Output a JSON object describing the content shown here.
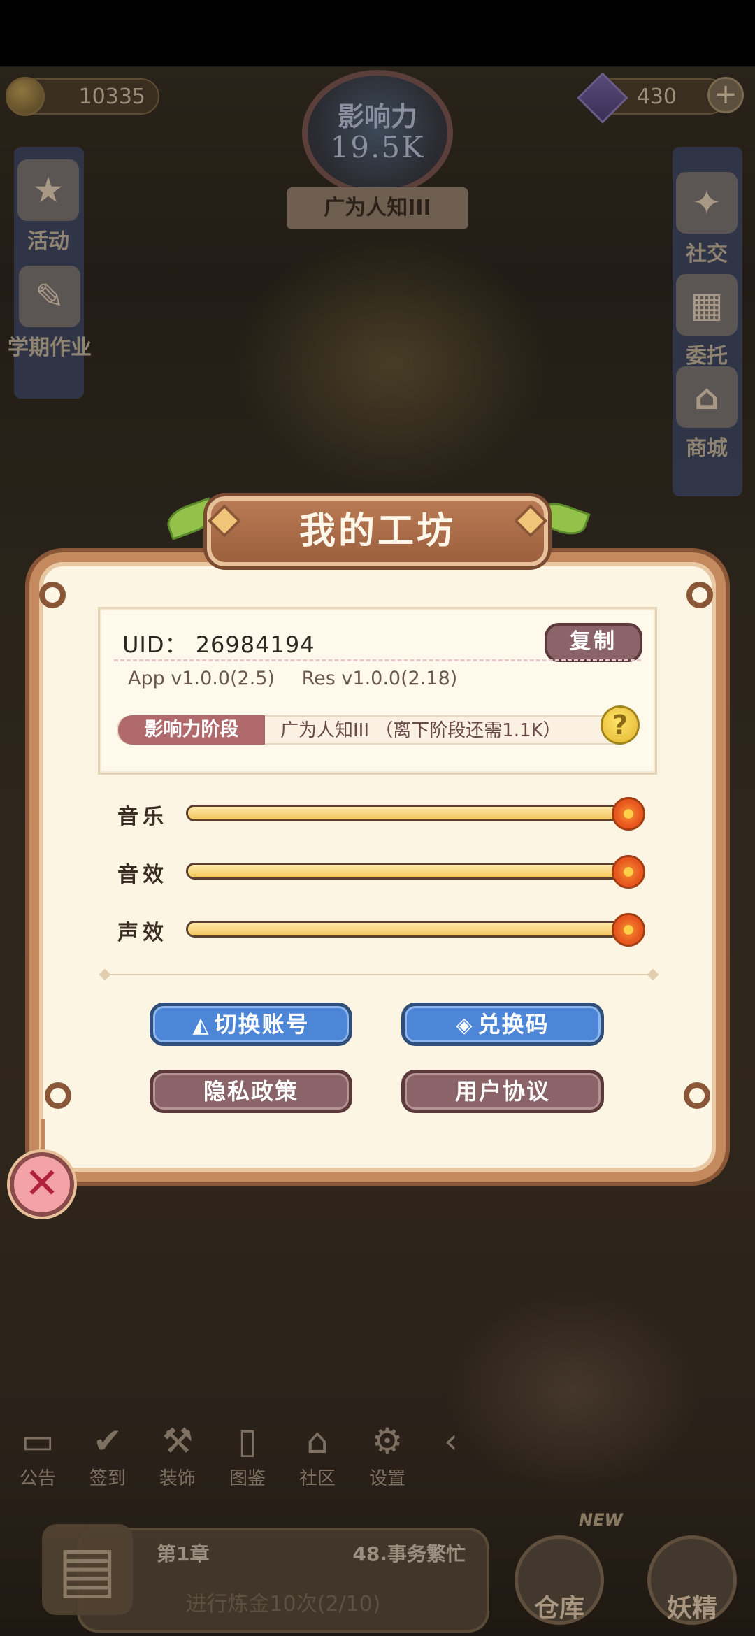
{
  "hud": {
    "coins": "10335",
    "gems": "430",
    "influence_label": "影响力",
    "influence_value": "19.5K",
    "rank_title": "广为人知III"
  },
  "left_menu": [
    {
      "label": "活动",
      "icon": "event-icon"
    },
    {
      "label": "学期作业",
      "icon": "homework-icon"
    }
  ],
  "right_menu": [
    {
      "label": "社交",
      "icon": "social-icon"
    },
    {
      "label": "委托",
      "icon": "commission-icon"
    },
    {
      "label": "商城",
      "icon": "shop-icon"
    }
  ],
  "bottom_menu": [
    {
      "label": "公告",
      "icon": "notice-icon"
    },
    {
      "label": "签到",
      "icon": "checkin-icon"
    },
    {
      "label": "装饰",
      "icon": "decor-icon"
    },
    {
      "label": "图鉴",
      "icon": "codex-icon"
    },
    {
      "label": "社区",
      "icon": "community-icon"
    },
    {
      "label": "设置",
      "icon": "settings-icon"
    }
  ],
  "quest": {
    "chapter": "第1章",
    "name": "48.事务繁忙",
    "task": "进行炼金10次(2/10)"
  },
  "bottom_buttons": {
    "warehouse": "仓库",
    "fairy": "妖精",
    "new_badge": "NEW"
  },
  "modal": {
    "title": "我的工坊",
    "uid_label": "UID：",
    "uid_value": "26984194",
    "copy_label": "复制",
    "app_version": "App v1.0.0(2.5)",
    "res_version": "Res v1.0.0(2.18)",
    "stage_label": "影响力阶段",
    "stage_text": "广为人知III （离下阶段还需1.1K）",
    "sliders": [
      {
        "label": "音乐",
        "value": 1.0
      },
      {
        "label": "音效",
        "value": 1.0
      },
      {
        "label": "声效",
        "value": 1.0
      }
    ],
    "switch_account": "切换账号",
    "redeem_code": "兑换码",
    "privacy_policy": "隐私政策",
    "user_agreement": "用户协议"
  },
  "colors": {
    "modal_bg": "#fdf5e3",
    "modal_border": "#c48a5e",
    "btn_blue": "#4d86d6",
    "btn_mauve": "#8a6468",
    "stage_tag": "#b06a6c"
  }
}
